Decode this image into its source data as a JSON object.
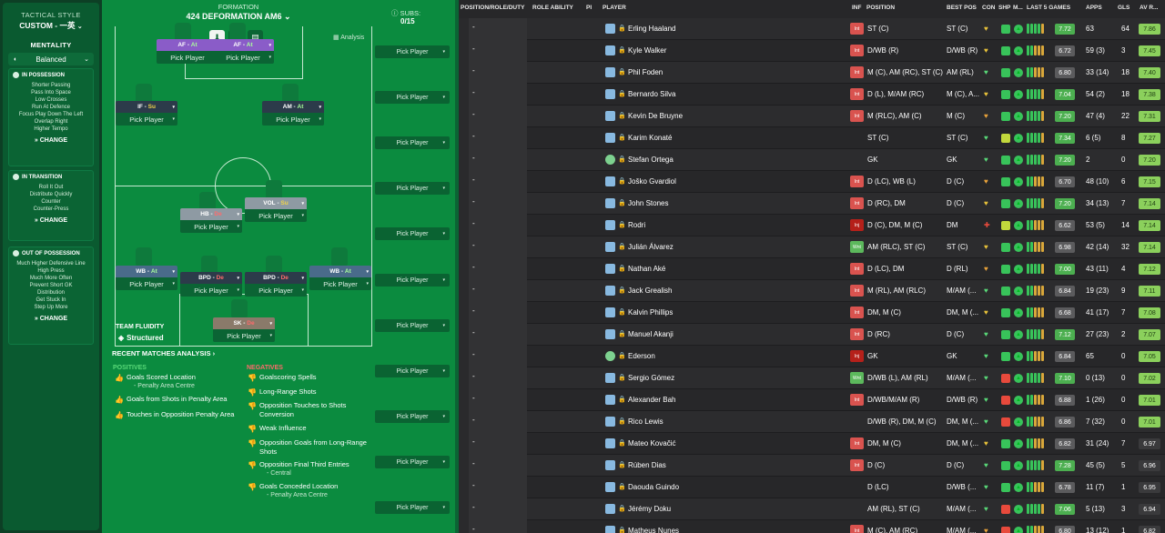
{
  "left": {
    "title": "TACTICAL STYLE",
    "style_name": "CUSTOM - 一英",
    "mentality_label": "MENTALITY",
    "mentality_value": "Balanced",
    "in_possession": {
      "title": "IN POSSESSION",
      "items": [
        "Shorter Passing",
        "Pass Into Space",
        "Low Crosses",
        "Run At Defence",
        "Focus Play Down The Left",
        "Overlap Right",
        "Higher Tempo"
      ],
      "change": "CHANGE"
    },
    "in_transition": {
      "title": "IN TRANSITION",
      "items": [
        "Roll It Out",
        "Distribute Quickly",
        "Counter",
        "Counter-Press"
      ],
      "change": "CHANGE"
    },
    "out_of_possession": {
      "title": "OUT OF POSSESSION",
      "items": [
        "Much Higher Defensive Line",
        "High Press",
        "Much More Often",
        "Prevent Short GK",
        "Distribution",
        "Get Stuck In",
        "Step Up More"
      ],
      "change": "CHANGE"
    }
  },
  "pitch": {
    "formation_label": "FORMATION",
    "formation_name": "424 DEFORMATION AM6",
    "subs_label": "SUBS:",
    "subs_count": "0/15",
    "analysis": "Analysis",
    "pick_player": "Pick Player",
    "team_fluidity": "TEAM FLUIDITY",
    "fluidity_value": "Structured",
    "positions": [
      {
        "role": "AF",
        "duty": "At"
      },
      {
        "role": "AF",
        "duty": "At"
      },
      {
        "role": "IF",
        "duty": "Su"
      },
      {
        "role": "AM",
        "duty": "At"
      },
      {
        "role": "VOL",
        "duty": "Su"
      },
      {
        "role": "HB",
        "duty": "De"
      },
      {
        "role": "WB",
        "duty": "At"
      },
      {
        "role": "BPD",
        "duty": "De"
      },
      {
        "role": "BPD",
        "duty": "De"
      },
      {
        "role": "WB",
        "duty": "At"
      },
      {
        "role": "SK",
        "duty": "De"
      }
    ]
  },
  "analysis": {
    "title": "RECENT MATCHES ANALYSIS",
    "positives_label": "POSITIVES",
    "negatives_label": "NEGATIVES",
    "positives": [
      {
        "text": "Goals Scored Location",
        "sub": "- Penalty Area Centre"
      },
      {
        "text": "Goals from Shots in Penalty Area",
        "sub": ""
      },
      {
        "text": "Touches in Opposition Penalty Area",
        "sub": ""
      }
    ],
    "negatives": [
      {
        "text": "Goalscoring Spells",
        "sub": ""
      },
      {
        "text": "Long-Range Shots",
        "sub": ""
      },
      {
        "text": "Opposition Touches to Shots Conversion",
        "sub": ""
      },
      {
        "text": "Weak Influence",
        "sub": ""
      },
      {
        "text": "Opposition Goals from Long-Range Shots",
        "sub": ""
      },
      {
        "text": "Opposition Final Third Entries",
        "sub": "- Central"
      },
      {
        "text": "Goals Conceded Location",
        "sub": "- Penalty Area Centre"
      }
    ]
  },
  "table": {
    "headers": {
      "position": "POSITION/ROLE/DUTY",
      "role_ability": "ROLE ABILITY",
      "pi": "PI",
      "player": "PLAYER",
      "inf": "INF",
      "position_col": "POSITION",
      "best_pos": "BEST POS",
      "con": "CON",
      "shp": "SHP",
      "m": "M...",
      "last5": "LAST 5 GAMES",
      "apps": "APPS",
      "gls": "GLS",
      "av_r": "AV R..."
    },
    "rows": [
      {
        "name": "Erling Haaland",
        "inf": "Int",
        "position": "ST (C)",
        "best": "ST (C)",
        "rating": "7.72",
        "apps": "63",
        "gls": "64",
        "av": "7.86",
        "kit": "out",
        "con": "heart-yellow",
        "shp": "#38c35a",
        "form_good": true
      },
      {
        "name": "Kyle Walker",
        "inf": "Int",
        "position": "D/WB (R)",
        "best": "D/WB (R)",
        "rating": "6.72",
        "apps": "59 (3)",
        "gls": "3",
        "av": "7.45",
        "kit": "out",
        "con": "heart-yellow",
        "shp": "#38c35a",
        "form_good": false
      },
      {
        "name": "Phil Foden",
        "inf": "Int",
        "position": "M (C), AM (RC), ST (C)",
        "best": "AM (RL)",
        "rating": "6.80",
        "apps": "33 (14)",
        "gls": "18",
        "av": "7.40",
        "kit": "out",
        "con": "heart-green",
        "shp": "#38c35a",
        "form_good": false
      },
      {
        "name": "Bernardo Silva",
        "inf": "Int",
        "position": "D (L), M/AM (RC)",
        "best": "M (C), A...",
        "rating": "7.04",
        "apps": "54 (2)",
        "gls": "18",
        "av": "7.38",
        "kit": "out",
        "con": "heart-yellow",
        "shp": "#38c35a",
        "form_good": true
      },
      {
        "name": "Kevin De Bruyne",
        "inf": "Int",
        "position": "M (RLC), AM (C)",
        "best": "M (C)",
        "rating": "7.20",
        "apps": "47 (4)",
        "gls": "22",
        "av": "7.31",
        "kit": "out",
        "con": "heart-orange",
        "shp": "#38c35a",
        "form_good": true
      },
      {
        "name": "Karim Konaté",
        "inf": "",
        "position": "ST (C)",
        "best": "ST (C)",
        "rating": "7.34",
        "apps": "6 (5)",
        "gls": "8",
        "av": "7.27",
        "kit": "out",
        "con": "heart-green",
        "shp": "#c2d83c",
        "form_good": true
      },
      {
        "name": "Stefan Ortega",
        "inf": "",
        "position": "GK",
        "best": "GK",
        "rating": "7.20",
        "apps": "2",
        "gls": "0",
        "av": "7.20",
        "kit": "gk",
        "con": "heart-green",
        "shp": "#38c35a",
        "form_good": true
      },
      {
        "name": "Joško Gvardiol",
        "inf": "Int",
        "position": "D (LC), WB (L)",
        "best": "D (C)",
        "rating": "6.70",
        "apps": "48 (10)",
        "gls": "6",
        "av": "7.15",
        "kit": "out",
        "con": "heart-orange",
        "shp": "#38c35a",
        "form_good": false
      },
      {
        "name": "John Stones",
        "inf": "Int",
        "position": "D (RC), DM",
        "best": "D (C)",
        "rating": "7.20",
        "apps": "34 (13)",
        "gls": "7",
        "av": "7.14",
        "kit": "out",
        "con": "heart-yellow",
        "shp": "#38c35a",
        "form_good": true
      },
      {
        "name": "Rodri",
        "inf": "Inj",
        "position": "D (C), DM, M (C)",
        "best": "DM",
        "rating": "6.62",
        "apps": "53 (5)",
        "gls": "14",
        "av": "7.14",
        "kit": "out",
        "con": "injury",
        "shp": "#c2d83c",
        "form_good": false
      },
      {
        "name": "Julián Álvarez",
        "inf": "Wnt",
        "position": "AM (RLC), ST (C)",
        "best": "ST (C)",
        "rating": "6.98",
        "apps": "42 (14)",
        "gls": "32",
        "av": "7.14",
        "kit": "out",
        "con": "heart-yellow",
        "shp": "#38c35a",
        "form_good": false
      },
      {
        "name": "Nathan Aké",
        "inf": "Int",
        "position": "D (LC), DM",
        "best": "D (RL)",
        "rating": "7.00",
        "apps": "43 (11)",
        "gls": "4",
        "av": "7.12",
        "kit": "out",
        "con": "heart-orange",
        "shp": "#38c35a",
        "form_good": true
      },
      {
        "name": "Jack Grealish",
        "inf": "Int",
        "position": "M (RL), AM (RLC)",
        "best": "M/AM (...",
        "rating": "6.84",
        "apps": "19 (23)",
        "gls": "9",
        "av": "7.11",
        "kit": "out",
        "con": "heart-green",
        "shp": "#38c35a",
        "form_good": false
      },
      {
        "name": "Kalvin Phillips",
        "inf": "Int",
        "position": "DM, M (C)",
        "best": "DM, M (...",
        "rating": "6.68",
        "apps": "41 (17)",
        "gls": "7",
        "av": "7.08",
        "kit": "out",
        "con": "heart-yellow",
        "shp": "#38c35a",
        "form_good": false
      },
      {
        "name": "Manuel Akanji",
        "inf": "Int",
        "position": "D (RC)",
        "best": "D (C)",
        "rating": "7.12",
        "apps": "27 (23)",
        "gls": "2",
        "av": "7.07",
        "kit": "out",
        "con": "heart-green",
        "shp": "#38c35a",
        "form_good": true
      },
      {
        "name": "Ederson",
        "inf": "Inj",
        "position": "GK",
        "best": "GK",
        "rating": "6.84",
        "apps": "65",
        "gls": "0",
        "av": "7.05",
        "kit": "gk",
        "con": "heart-green",
        "shp": "#38c35a",
        "form_good": false
      },
      {
        "name": "Sergio Gómez",
        "inf": "Wnt",
        "position": "D/WB (L), AM (RL)",
        "best": "M/AM (...",
        "rating": "7.10",
        "apps": "0 (13)",
        "gls": "0",
        "av": "7.02",
        "kit": "out",
        "con": "heart-green",
        "shp": "#e84a3c",
        "form_good": true
      },
      {
        "name": "Alexander Bah",
        "inf": "Int",
        "position": "D/WB/M/AM (R)",
        "best": "D/WB (R)",
        "rating": "6.88",
        "apps": "1 (26)",
        "gls": "0",
        "av": "7.01",
        "kit": "out",
        "con": "heart-green",
        "shp": "#e84a3c",
        "form_good": false
      },
      {
        "name": "Rico Lewis",
        "inf": "",
        "position": "D/WB (R), DM, M (C)",
        "best": "DM, M (...",
        "rating": "6.86",
        "apps": "7 (32)",
        "gls": "0",
        "av": "7.01",
        "kit": "out",
        "con": "heart-green",
        "shp": "#e84a3c",
        "form_good": false
      },
      {
        "name": "Mateo Kovačić",
        "inf": "Int",
        "position": "DM, M (C)",
        "best": "DM, M (...",
        "rating": "6.82",
        "apps": "31 (24)",
        "gls": "7",
        "av": "6.97",
        "kit": "out",
        "con": "heart-yellow",
        "shp": "#38c35a",
        "form_good": false
      },
      {
        "name": "Rúben Dias",
        "inf": "Int",
        "position": "D (C)",
        "best": "D (C)",
        "rating": "7.28",
        "apps": "45 (5)",
        "gls": "5",
        "av": "6.96",
        "kit": "out",
        "con": "heart-green",
        "shp": "#38c35a",
        "form_good": true
      },
      {
        "name": "Daouda Guindo",
        "inf": "",
        "position": "D (LC)",
        "best": "D/WB (...",
        "rating": "6.78",
        "apps": "11 (7)",
        "gls": "1",
        "av": "6.95",
        "kit": "out",
        "con": "heart-green",
        "shp": "#38c35a",
        "form_good": false
      },
      {
        "name": "Jérémy Doku",
        "inf": "",
        "position": "AM (RL), ST (C)",
        "best": "M/AM (...",
        "rating": "7.06",
        "apps": "5 (13)",
        "gls": "3",
        "av": "6.94",
        "kit": "out",
        "con": "heart-green",
        "shp": "#e84a3c",
        "form_good": true
      },
      {
        "name": "Matheus Nunes",
        "inf": "Int",
        "position": "M (C), AM (RC)",
        "best": "M/AM (...",
        "rating": "6.80",
        "apps": "13 (12)",
        "gls": "1",
        "av": "6.82",
        "kit": "out",
        "con": "heart-orange",
        "shp": "#e84a3c",
        "form_good": false
      }
    ]
  }
}
